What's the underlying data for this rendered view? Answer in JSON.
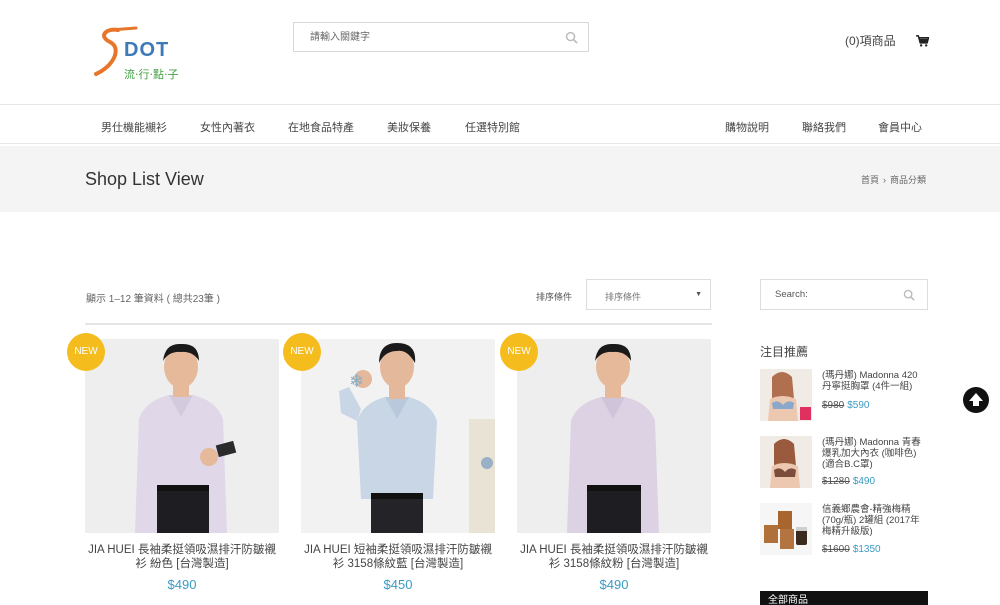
{
  "header": {
    "logo_text": "DOT",
    "logo_sub": "流·行·點·子",
    "search_placeholder": "請輸入關鍵字",
    "cart_label": "(0)項商品"
  },
  "nav": {
    "left": [
      "男仕機能襯衫",
      "女性內著衣",
      "在地食品特產",
      "美妝保養",
      "任選特別館"
    ],
    "right": [
      "購物說明",
      "聯絡我們",
      "會員中心"
    ]
  },
  "page": {
    "title": "Shop List View",
    "breadcrumb": [
      "首頁",
      "商品分類"
    ]
  },
  "listing": {
    "result_count": "顯示 1–12 筆資料 ( 總共23筆 )",
    "sort_label": "排序條件",
    "sort_value": "排序條件"
  },
  "products": [
    {
      "badge": "NEW",
      "name": "JIA HUEI 長袖柔挺領吸濕排汗防皺襯衫 紛色 [台灣製造]",
      "price": "$490"
    },
    {
      "badge": "NEW",
      "name": "JIA HUEI 短袖柔挺領吸濕排汗防皺襯衫 3158條紋藍 [台灣製造]",
      "price": "$450"
    },
    {
      "badge": "NEW",
      "name": "JIA HUEI 長袖柔挺領吸濕排汗防皺襯衫 3158條紋粉 [台灣製造]",
      "price": "$490"
    }
  ],
  "sidebar": {
    "search_placeholder": "Search:",
    "featured_title": "注目推薦",
    "featured": [
      {
        "name": "(瑪丹娜) Madonna 420 丹寧挺胸罩 (4件一組)",
        "old_price": "$980",
        "price": "$590"
      },
      {
        "name": "(瑪丹娜) Madonna 青春爆乳加大內衣 (咖啡色)(適合B.C罩)",
        "old_price": "$1280",
        "price": "$490"
      },
      {
        "name": "信義鄉農會-精強梅精(70g/瓶) 2罐組 (2017年梅精升級版)",
        "old_price": "$1600",
        "price": "$1350"
      }
    ],
    "all_products": "全部商品"
  },
  "colors": {
    "accent_price": "#3a9bc4",
    "badge": "#f4bc1c",
    "title_bar": "#f4f4f4"
  },
  "icons": [
    "search-icon",
    "cart-icon",
    "back-to-top-icon",
    "chevron-down-icon",
    "chevron-right-icon"
  ]
}
